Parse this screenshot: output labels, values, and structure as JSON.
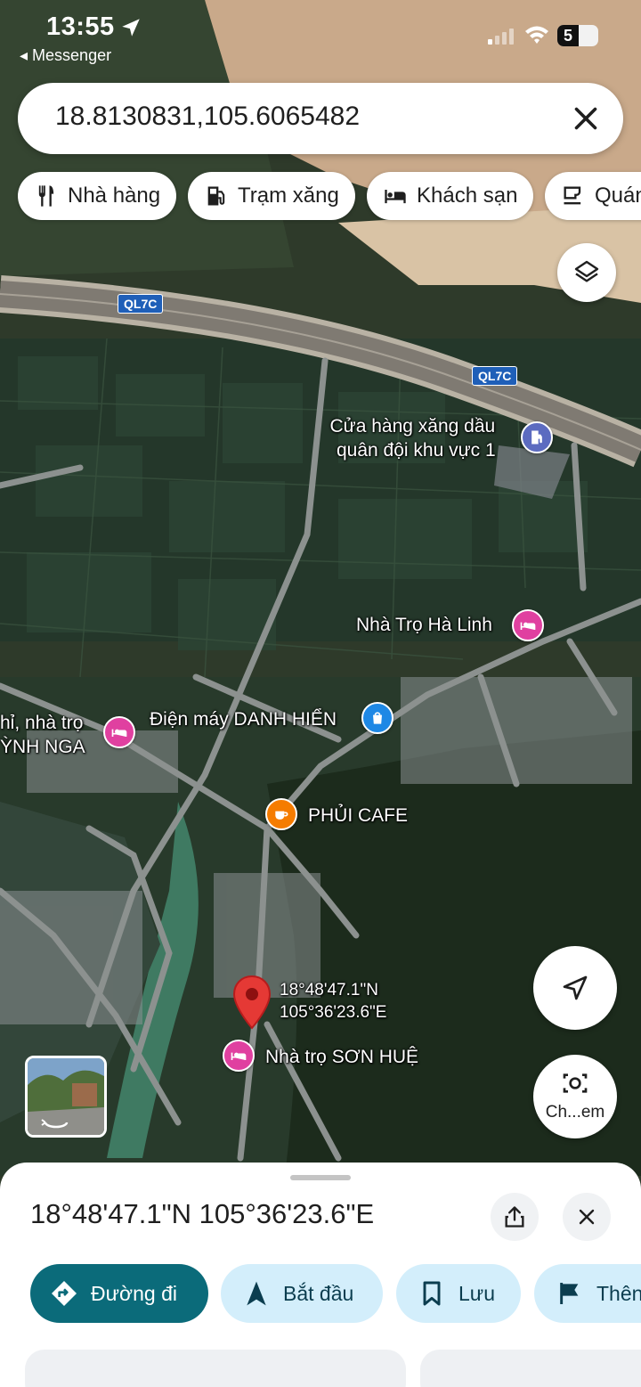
{
  "status_bar": {
    "time": "13:55",
    "back_app": "◂ Messenger",
    "battery": "5"
  },
  "search": {
    "query": "18.8130831,105.6065482"
  },
  "chips": [
    {
      "label": "Nhà hàng",
      "icon": "restaurant-icon"
    },
    {
      "label": "Trạm xăng",
      "icon": "gas-station-icon"
    },
    {
      "label": "Khách sạn",
      "icon": "hotel-icon"
    },
    {
      "label": "Quán",
      "icon": "cafe-icon"
    }
  ],
  "map": {
    "road_shields": [
      "QL7C",
      "QL7C"
    ],
    "places": {
      "gas_station": {
        "line1": "Cửa hàng xăng dầu",
        "line2": "quân đội khu vực 1"
      },
      "ha_linh": "Nhà Trọ Hà Linh",
      "dien_may": "Điện máy DANH HIỂN",
      "huynh_nga": {
        "line1": "hỉ, nhà trọ",
        "line2": "ỲNH NGA"
      },
      "phui_cafe": "PHỦI CAFE",
      "son_hue": "Nhà trọ SƠN HUỆ"
    },
    "pin": {
      "line1": "18°48'47.1\"N",
      "line2": "105°36'23.6\"E"
    },
    "camera_button_label": "Ch...em",
    "colors": {
      "pin": "#e53935",
      "lodging_poi": "#e040a0",
      "shop_poi": "#1e88e5",
      "cafe_poi": "#f57c00",
      "gas_poi": "#5c6bc0"
    }
  },
  "sheet": {
    "coordinates": "18°48'47.1\"N 105°36'23.6\"E",
    "actions": [
      {
        "label": "Đường đi",
        "icon": "directions-icon"
      },
      {
        "label": "Bắt đầu",
        "icon": "navigation-arrow-icon"
      },
      {
        "label": "Lưu",
        "icon": "bookmark-icon"
      },
      {
        "label": "Thên",
        "icon": "flag-icon"
      }
    ],
    "colors": {
      "primary": "#0b6b7a",
      "secondary": "#d3eefb"
    }
  }
}
